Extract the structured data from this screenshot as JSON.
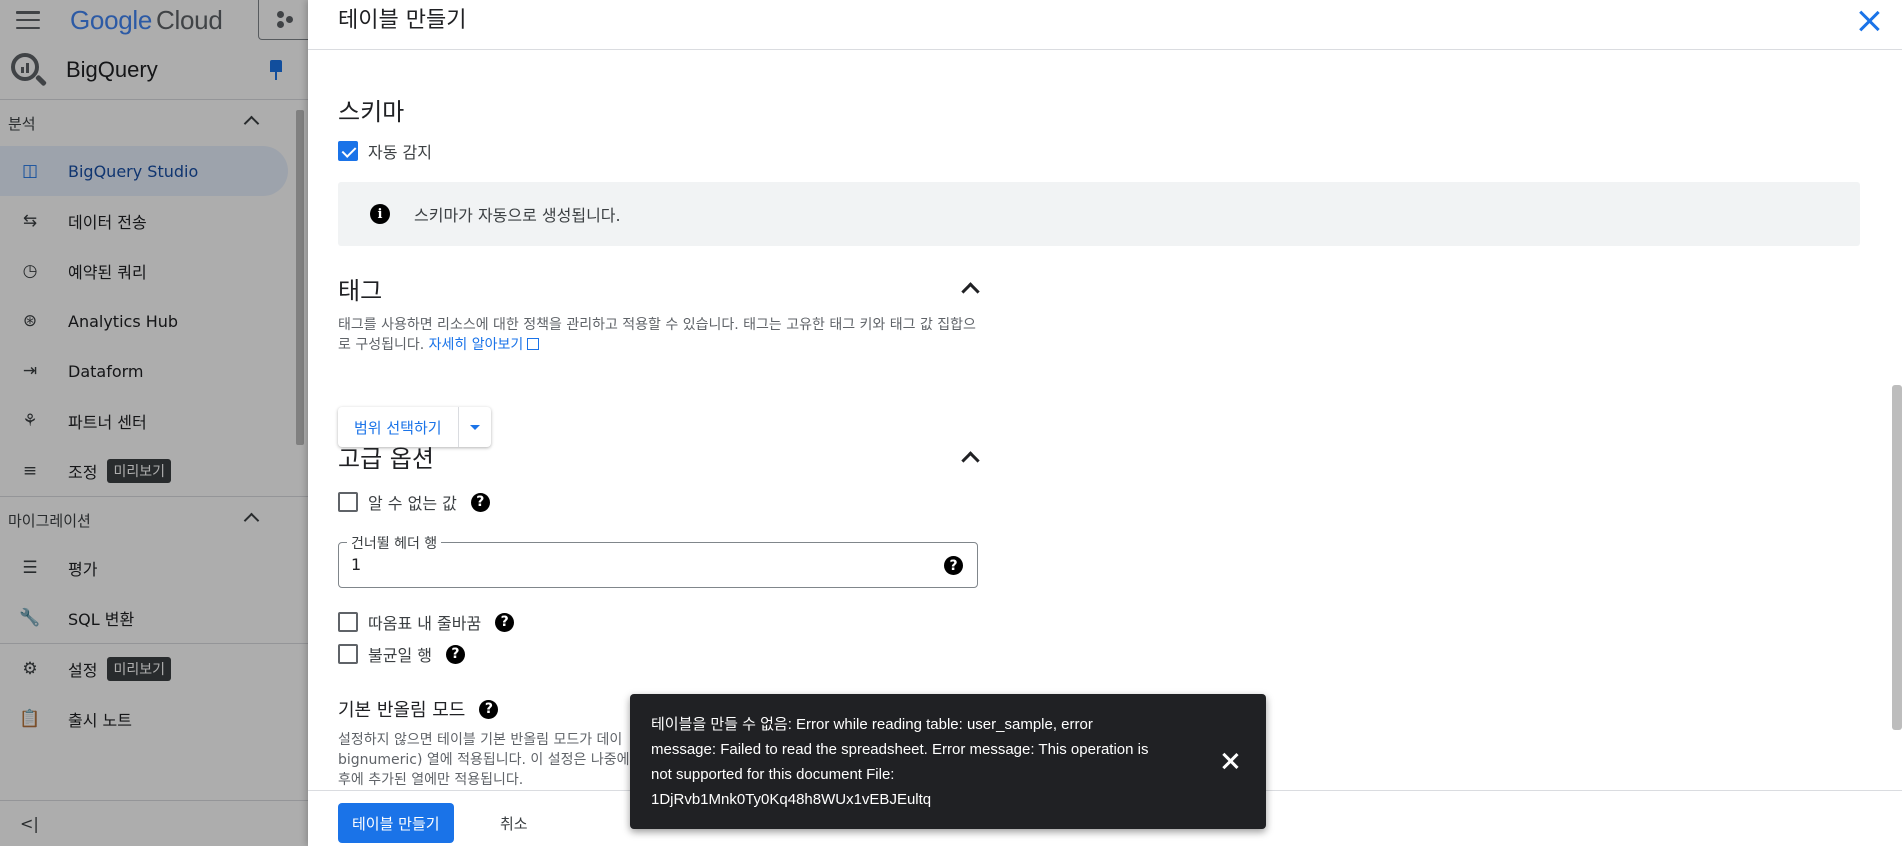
{
  "app": {
    "logo_google": "Google",
    "logo_cloud": "Cloud",
    "product": "BigQuery"
  },
  "sidebar": {
    "section_analysis": "분석",
    "items": [
      {
        "label": "BigQuery Studio",
        "icon": "studio-icon"
      },
      {
        "label": "데이터 전송",
        "icon": "transfer-icon"
      },
      {
        "label": "예약된 쿼리",
        "icon": "clock-icon"
      },
      {
        "label": "Analytics Hub",
        "icon": "hub-icon"
      },
      {
        "label": "Dataform",
        "icon": "dataform-icon"
      },
      {
        "label": "파트너 센터",
        "icon": "partner-icon"
      },
      {
        "label": "조정",
        "icon": "tune-icon",
        "badge": "미리보기"
      }
    ],
    "section_migration": "마이그레이션",
    "migration_items": [
      {
        "label": "평가",
        "icon": "list-icon"
      },
      {
        "label": "SQL 변환",
        "icon": "wrench-icon"
      }
    ],
    "settings": {
      "label": "설정",
      "badge": "미리보기"
    },
    "release_notes": "출시 노트",
    "collapse_glyph": "<|"
  },
  "panel": {
    "title": "테이블 만들기",
    "schema": {
      "heading": "스키마",
      "auto_detect_label": "자동 감지",
      "auto_detect_checked": true,
      "info_text": "스키마가 자동으로 생성됩니다."
    },
    "tags": {
      "heading": "태그",
      "description": "태그를 사용하면 리소스에 대한 정책을 관리하고 적용할 수 있습니다. 태그는 고유한 태그 키와 태그 값 집합으로 구성됩니다.",
      "learn_more": "자세히 알아보기",
      "scope_button": "범위 선택하기"
    },
    "advanced": {
      "heading": "고급 옵션",
      "unknown_values_label": "알 수 없는 값",
      "skip_header_label": "건너뛸 헤더 행",
      "skip_header_value": "1",
      "quoted_newlines_label": "따옴표 내 줄바꿈",
      "jagged_rows_label": "불균일 행",
      "rounding_heading": "기본 반올림 모드",
      "rounding_desc_1": "설정하지 않으면 테이블 기본 반올림 모드가 데이",
      "rounding_desc_2": "bignumeric) 열에 적용됩니다. 이 설정은 나중에",
      "rounding_desc_3": "후에 추가된 열에만 적용됩니다."
    },
    "footer": {
      "create_button": "테이블 만들기",
      "cancel_button": "취소"
    }
  },
  "snackbar": {
    "message": "테이블을 만들 수 없음: Error while reading table: user_sample, error message: Failed to read the spreadsheet. Error message: This operation is not supported for this document File: 1DjRvb1Mnk0Ty0Kq48h8WUx1vEBJEultq"
  },
  "colors": {
    "accent": "#1a73e8",
    "snackbar_bg": "#202124",
    "info_bg": "#f1f3f4"
  }
}
